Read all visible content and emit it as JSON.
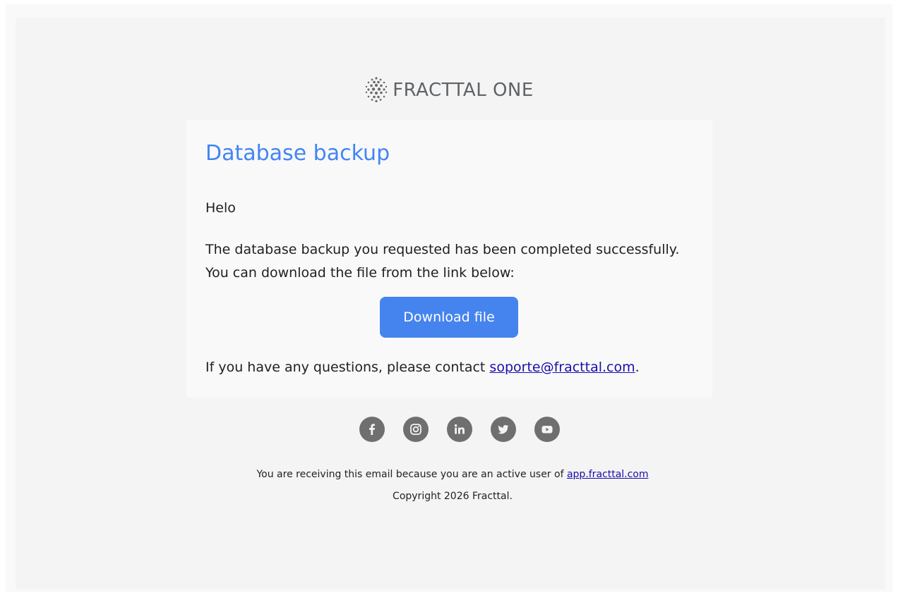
{
  "brand": {
    "name": "FRACTTAL ONE",
    "logo_icon": "dotted-sphere-logo"
  },
  "colors": {
    "title_blue": "#4285f4",
    "button_blue": "#4584ee",
    "link_blue": "#1a0dab",
    "icon_gray": "#6f6f6f"
  },
  "card": {
    "title": "Database backup",
    "greeting": "Helo",
    "body_line_1": "The database backup you requested has been completed successfully.",
    "body_line_2": "You can download the file from the link below:",
    "download_label": "Download file",
    "contact_prefix": "If you have any questions, please contact ",
    "contact_email": "soporte@fracttal.com",
    "contact_suffix": "."
  },
  "social": [
    {
      "name": "facebook",
      "icon": "facebook-icon"
    },
    {
      "name": "instagram",
      "icon": "instagram-icon"
    },
    {
      "name": "linkedin",
      "icon": "linkedin-icon"
    },
    {
      "name": "twitter",
      "icon": "twitter-icon"
    },
    {
      "name": "youtube",
      "icon": "youtube-icon"
    }
  ],
  "footer": {
    "notice_prefix": "You are receiving this email because you are an active user of ",
    "notice_link": "app.fracttal.com",
    "copyright": "Copyright 2026 Fracttal."
  }
}
